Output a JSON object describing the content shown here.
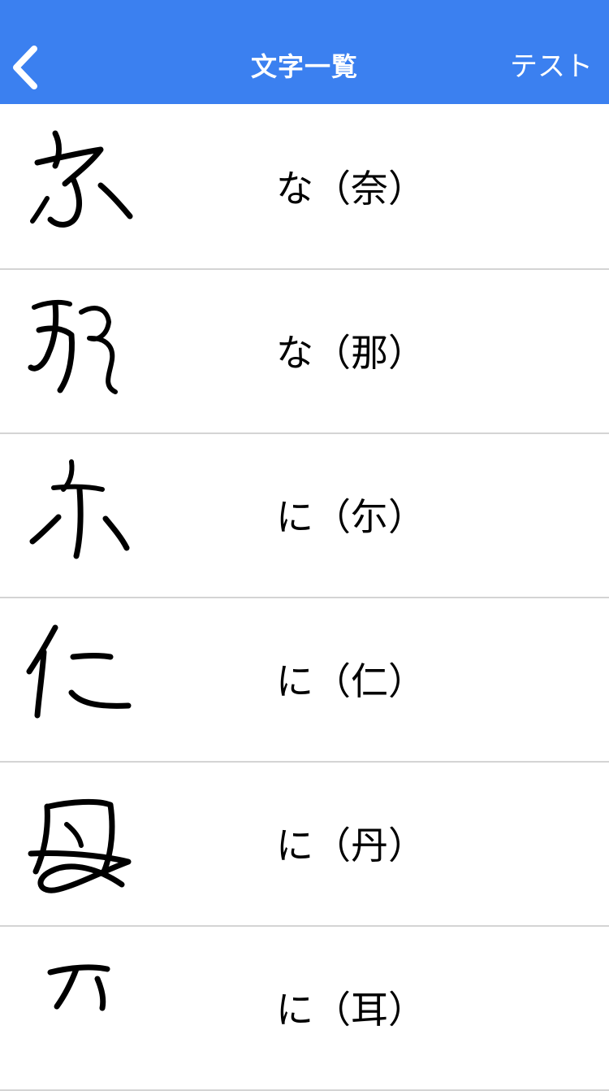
{
  "header": {
    "title": "文字一覧",
    "back_icon": "chevron-left-icon",
    "right_button": "テスト",
    "bg_color": "#3b80f0",
    "text_color": "#ffffff"
  },
  "rows": [
    {
      "label": "な（奈）",
      "glyph": "hentaigana-na-nara-icon"
    },
    {
      "label": "な（那）",
      "glyph": "hentaigana-na-na-icon"
    },
    {
      "label": "に（尓）",
      "glyph": "hentaigana-ni-ni-icon"
    },
    {
      "label": "に（仁）",
      "glyph": "hentaigana-ni-jin-icon"
    },
    {
      "label": "に（丹）",
      "glyph": "hentaigana-ni-tan-icon"
    },
    {
      "label": "に（耳）",
      "glyph": "hentaigana-ni-mimi-icon"
    }
  ]
}
